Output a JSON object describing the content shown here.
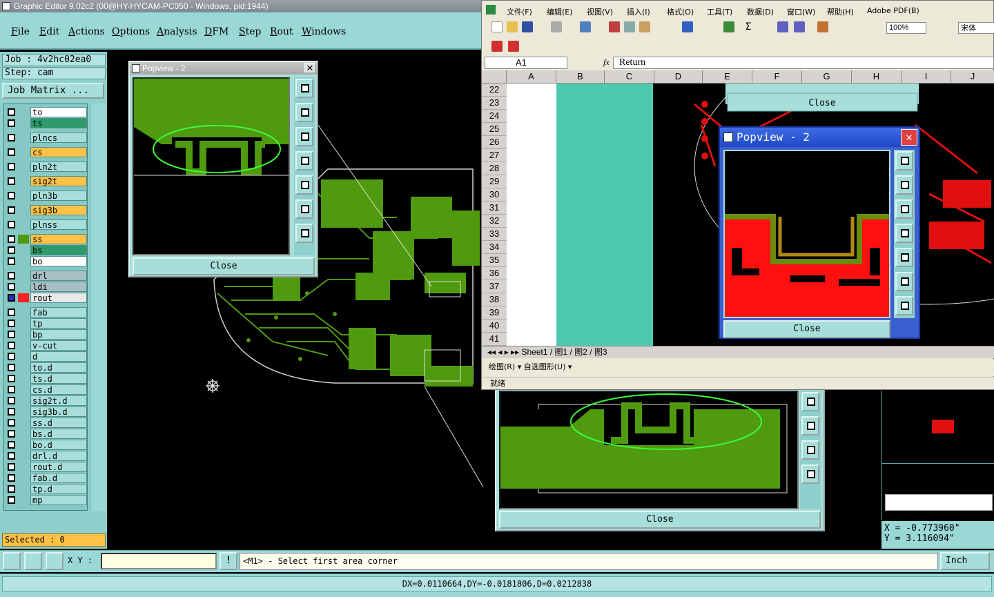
{
  "app": {
    "title": "Graphic Editor 9.02c2 (00@HY-HYCAM-PC050 - Windows, pid:1944)"
  },
  "menu": [
    "File",
    "Edit",
    "Actions",
    "Options",
    "Analysis",
    "DFM",
    "Step",
    "Rout",
    "Windows"
  ],
  "job": {
    "job_label": "Job : 4v2hc02ea0",
    "step_label": "Step: cam",
    "matrix_button": "Job Matrix ..."
  },
  "layers": [
    {
      "name": "to",
      "color": "#ffffff"
    },
    {
      "name": "ts",
      "color": "#2f9a6a"
    },
    {
      "name": "plncs",
      "color": "#a8deda"
    },
    {
      "name": "cs",
      "color": "#ffc247"
    },
    {
      "name": "pln2t",
      "color": "#a8deda"
    },
    {
      "name": "sig2t",
      "color": "#ffc247"
    },
    {
      "name": "pln3b",
      "color": "#a8deda"
    },
    {
      "name": "sig3b",
      "color": "#ffc247"
    },
    {
      "name": "plnss",
      "color": "#a8deda"
    },
    {
      "name": "ss",
      "color": "#ffc247"
    },
    {
      "name": "bs",
      "color": "#2f9a6a"
    },
    {
      "name": "bo",
      "color": "#ffffff"
    },
    {
      "name": "drl",
      "color": "#a8c0c4"
    },
    {
      "name": "ldi",
      "color": "#a8c0c4"
    },
    {
      "name": "rout",
      "color": "#e8e8e8"
    },
    {
      "name": "fab",
      "color": "#a8deda"
    },
    {
      "name": "tp",
      "color": "#a8deda"
    },
    {
      "name": "bp",
      "color": "#a8deda"
    },
    {
      "name": "v-cut",
      "color": "#a8deda"
    },
    {
      "name": "d",
      "color": "#a8deda"
    },
    {
      "name": "to.d",
      "color": "#a8deda"
    },
    {
      "name": "ts.d",
      "color": "#a8deda"
    },
    {
      "name": "cs.d",
      "color": "#a8deda"
    },
    {
      "name": "sig2t.d",
      "color": "#a8deda"
    },
    {
      "name": "sig3b.d",
      "color": "#a8deda"
    },
    {
      "name": "ss.d",
      "color": "#a8deda"
    },
    {
      "name": "bs.d",
      "color": "#a8deda"
    },
    {
      "name": "bo.d",
      "color": "#a8deda"
    },
    {
      "name": "drl.d",
      "color": "#a8deda"
    },
    {
      "name": "rout.d",
      "color": "#a8deda"
    },
    {
      "name": "fab.d",
      "color": "#a8deda"
    },
    {
      "name": "tp.d",
      "color": "#a8deda"
    },
    {
      "name": "mp",
      "color": "#a8deda"
    }
  ],
  "selected": "Selected : 0",
  "popview1": {
    "title": "Popview - 2",
    "close": "Close"
  },
  "popview2": {
    "title": "Popview - 2",
    "close": "Close"
  },
  "popview3": {
    "close": "Close"
  },
  "popview4": {
    "close": "Close"
  },
  "bottom": {
    "xy_label": "X Y :",
    "prompt": "<M1> - Select first area corner",
    "units": "Inch"
  },
  "status": "DX=0.0110664,DY=-0.0181806,D=0.0212838",
  "coords": {
    "x": "X = -0.773960\"",
    "y": "Y = 3.116094\""
  },
  "excel": {
    "menu": [
      "文件(F)",
      "编辑(E)",
      "视图(V)",
      "插入(I)",
      "格式(O)",
      "工具(T)",
      "数据(D)",
      "窗口(W)",
      "帮助(H)",
      "Adobe PDF(B)"
    ],
    "zoom": "100%",
    "font": "宋体",
    "namebox": "A1",
    "fx": "fx",
    "formula": "Return",
    "columns": [
      "A",
      "B",
      "C",
      "D",
      "E",
      "F",
      "G",
      "H",
      "I",
      "J"
    ],
    "rows": [
      "22",
      "23",
      "24",
      "25",
      "26",
      "27",
      "28",
      "29",
      "30",
      "31",
      "32",
      "33",
      "34",
      "35",
      "36",
      "37",
      "38",
      "39",
      "40",
      "41"
    ],
    "tabs": "Sheet1 / 图1 / 图2 / 图3",
    "drawbar": "绘图(R) ▾   自选图形(U) ▾",
    "status": "就绪"
  }
}
